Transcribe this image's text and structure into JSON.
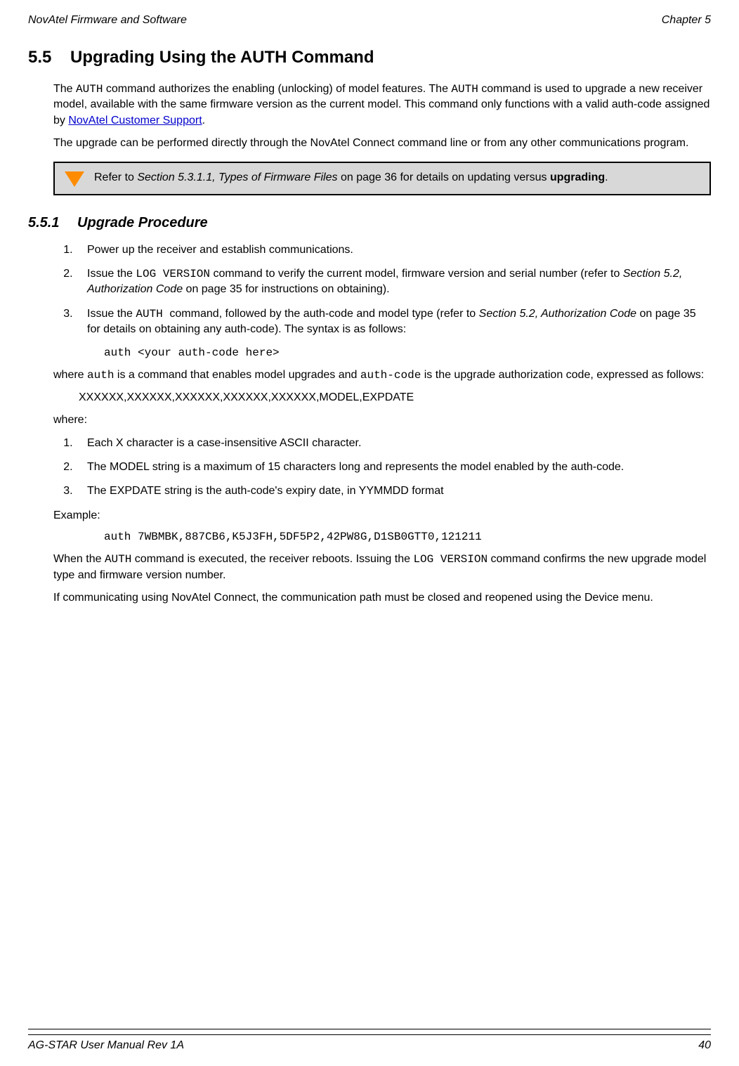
{
  "header": {
    "left": "NovAtel Firmware and Software",
    "right": "Chapter 5"
  },
  "footer": {
    "left": "AG-STAR User Manual Rev 1A",
    "right": "40"
  },
  "section": {
    "number": "5.5",
    "title": "Upgrading Using the AUTH Command"
  },
  "intro": {
    "p1_a": "The ",
    "p1_cmd1": "AUTH",
    "p1_b": " command authorizes the enabling (unlocking) of model features. The ",
    "p1_cmd2": "AUTH",
    "p1_c": " command is used to upgrade a new receiver model, available with the same firmware version as the current model. This command only functions with a valid auth-code assigned by ",
    "p1_link": "NovAtel Customer Support",
    "p1_d": ".",
    "p2": "The upgrade can be performed directly through the NovAtel Connect command line or from any other communications program."
  },
  "note": {
    "a": "Refer to ",
    "i": "Section 5.3.1.1, Types of Firmware Files",
    "b": " on page 36 for details on updating versus ",
    "bold": "upgrading",
    "c": "."
  },
  "subsection": {
    "number": "5.5.1",
    "title": "Upgrade Procedure"
  },
  "steps1": {
    "s1": "Power up the receiver and establish communications.",
    "s2_a": "Issue the ",
    "s2_cmd": "LOG VERSION",
    "s2_b": " command to verify the current model, firmware version and serial number (refer to ",
    "s2_i": "Section 5.2, Authorization Code",
    "s2_c": " on page 35 for instructions on obtaining).",
    "s3_a": "Issue the ",
    "s3_cmd": "AUTH ",
    "s3_b": " command, followed by the auth-code and model type (refer to ",
    "s3_i": "Section 5.2, Authorization Code",
    "s3_c": " on page 35 for details on obtaining any auth-code). The syntax is as follows:"
  },
  "code1": "auth <your auth-code here>",
  "where_intro_a": "where ",
  "where_intro_cmd1": "auth",
  "where_intro_b": " is a command that enables model upgrades and ",
  "where_intro_cmd2": "auth-code",
  "where_intro_c": " is the upgrade authorization code, expressed as follows:",
  "format": "XXXXXX,XXXXXX,XXXXXX,XXXXXX,XXXXXX,MODEL,EXPDATE",
  "where_label": "where:",
  "steps2": {
    "s1": "Each X character is a case-insensitive ASCII character.",
    "s2": "The MODEL string is a maximum of 15 characters long and represents the model enabled by the auth-code.",
    "s3": "The EXPDATE string is the auth-code's expiry date, in YYMMDD format"
  },
  "example_label": "Example:",
  "code2": "auth 7WBMBK,887CB6,K5J3FH,5DF5P2,42PW8G,D1SB0GTT0,121211",
  "closing": {
    "p1_a": "When the ",
    "p1_cmd1": "AUTH",
    "p1_b": " command is executed, the receiver reboots. Issuing the ",
    "p1_cmd2": "LOG VERSION",
    "p1_c": " command confirms the new upgrade model type and firmware version number.",
    "p2": "If communicating using NovAtel Connect, the communication path must be closed and reopened using the Device menu."
  }
}
